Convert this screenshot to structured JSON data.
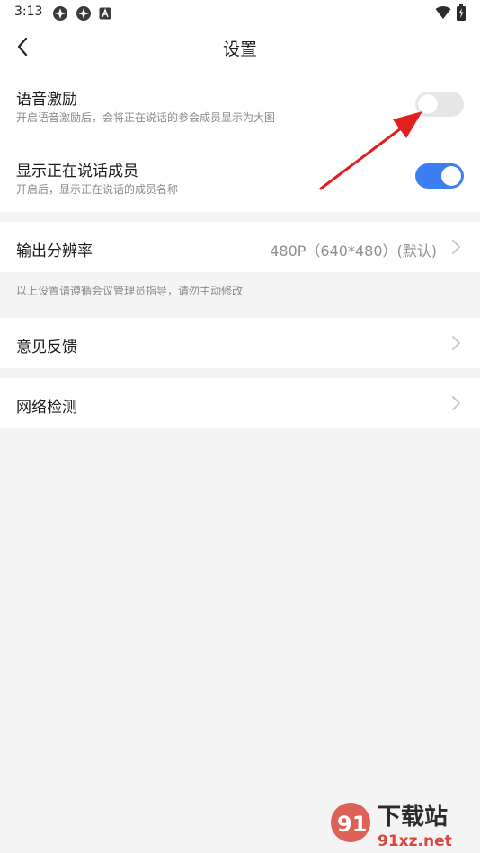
{
  "status_bar": {
    "time": "3:13",
    "left_icons": [
      "app-icon",
      "app-icon",
      "a-letter-icon"
    ],
    "right_icons": [
      "wifi-icon",
      "battery-charging-icon"
    ]
  },
  "header": {
    "title": "设置",
    "back_icon": "chevron-left-icon"
  },
  "settings": {
    "voice_incentive": {
      "title": "语音激励",
      "subtitle": "开启语音激励后，会将正在说话的参会成员显示为大图",
      "enabled": false
    },
    "show_speaking_member": {
      "title": "显示正在说话成员",
      "subtitle": "开启后，显示正在说话的成员名称",
      "enabled": true
    },
    "output_resolution": {
      "title": "输出分辨率",
      "value": "480P（640*480）(默认)"
    },
    "admin_note": "以上设置请遵循会议管理员指导，请勿主动修改",
    "feedback": {
      "title": "意见反馈"
    },
    "network_check": {
      "title": "网络检测"
    }
  },
  "colors": {
    "accent": "#3b7ff2",
    "toggle_off": "#e6e6e6",
    "background": "#f4f4f4",
    "annotation_arrow": "#e0201f"
  },
  "watermark": {
    "brand": "下载站",
    "url": "91xz.net"
  }
}
